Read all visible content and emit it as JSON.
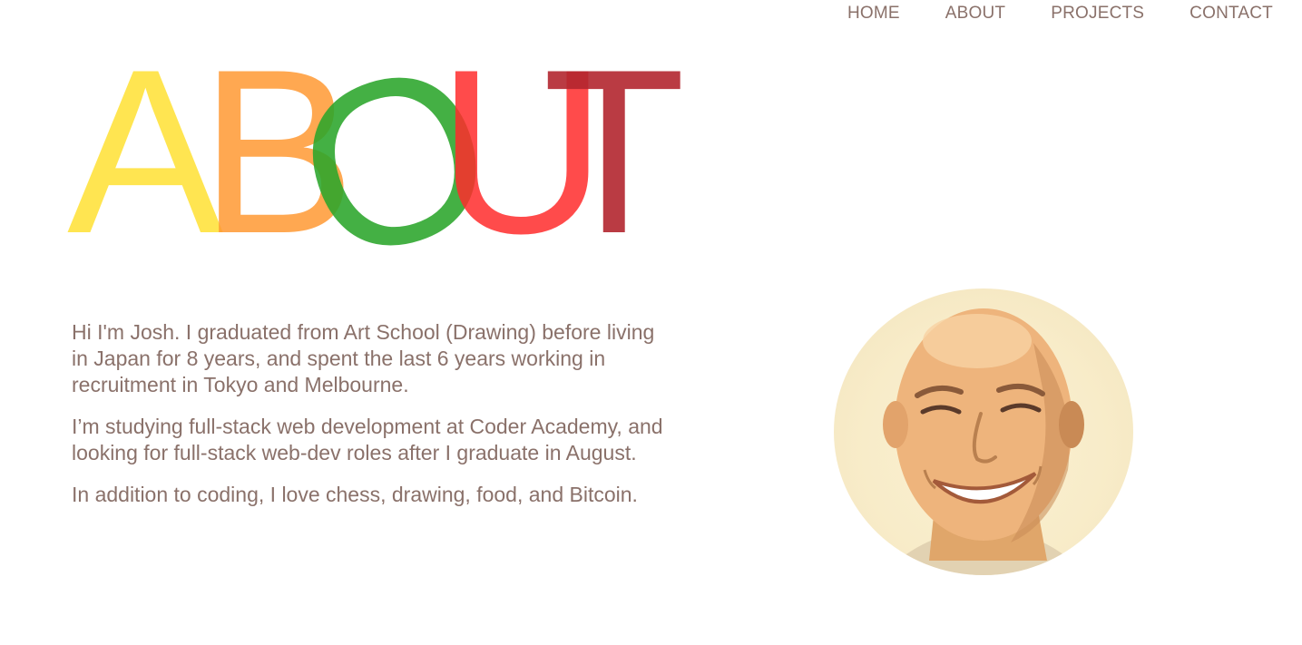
{
  "nav": {
    "items": [
      {
        "label": "HOME"
      },
      {
        "label": "ABOUT"
      },
      {
        "label": "PROJECTS"
      },
      {
        "label": "CONTACT"
      }
    ]
  },
  "hero": {
    "letters": [
      {
        "char": "A",
        "color": "#ffe033"
      },
      {
        "char": "B",
        "color": "#ff9933"
      },
      {
        "char": "O",
        "color": "#2aa52a"
      },
      {
        "char": "U",
        "color": "#ff2b2b"
      },
      {
        "char": "T",
        "color": "#b3262f"
      }
    ]
  },
  "bio": {
    "paragraphs": [
      "Hi I'm Josh. I graduated from Art School (Drawing) before living in Japan for 8 years, and spent the last 6 years working in recruitment in Tokyo and Melbourne.",
      "I’m studying full-stack web development at Coder Academy, and looking for full-stack web-dev roles after I graduate in August.",
      "In addition to coding, I love chess, drawing, food, and Bitcoin."
    ]
  },
  "colors": {
    "text": "#8a716a",
    "background": "#ffffff"
  }
}
